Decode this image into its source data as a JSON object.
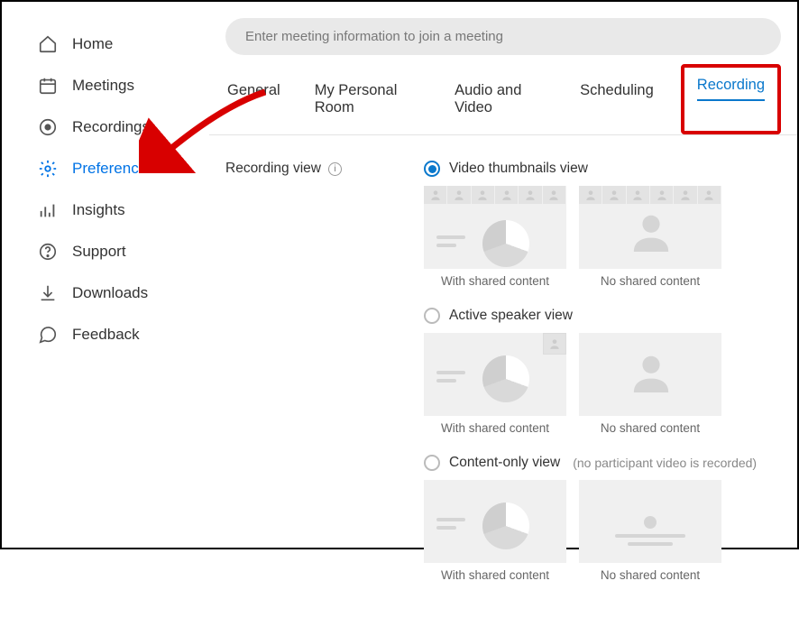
{
  "sidebar": {
    "items": [
      {
        "label": "Home"
      },
      {
        "label": "Meetings"
      },
      {
        "label": "Recordings"
      },
      {
        "label": "Preferences"
      },
      {
        "label": "Insights"
      },
      {
        "label": "Support"
      },
      {
        "label": "Downloads"
      },
      {
        "label": "Feedback"
      }
    ]
  },
  "search": {
    "placeholder": "Enter meeting information to join a meeting"
  },
  "tabs": [
    {
      "label": "General"
    },
    {
      "label": "My Personal Room"
    },
    {
      "label": "Audio and Video"
    },
    {
      "label": "Scheduling"
    },
    {
      "label": "Recording"
    }
  ],
  "section": {
    "label": "Recording view"
  },
  "options": [
    {
      "title": "Video thumbnails view",
      "hint": "",
      "captions": [
        "With shared content",
        "No shared content"
      ]
    },
    {
      "title": "Active speaker view",
      "hint": "",
      "captions": [
        "With shared content",
        "No shared content"
      ]
    },
    {
      "title": "Content-only view",
      "hint": "(no participant video is recorded)",
      "captions": [
        "With shared content",
        "No shared content"
      ]
    }
  ]
}
